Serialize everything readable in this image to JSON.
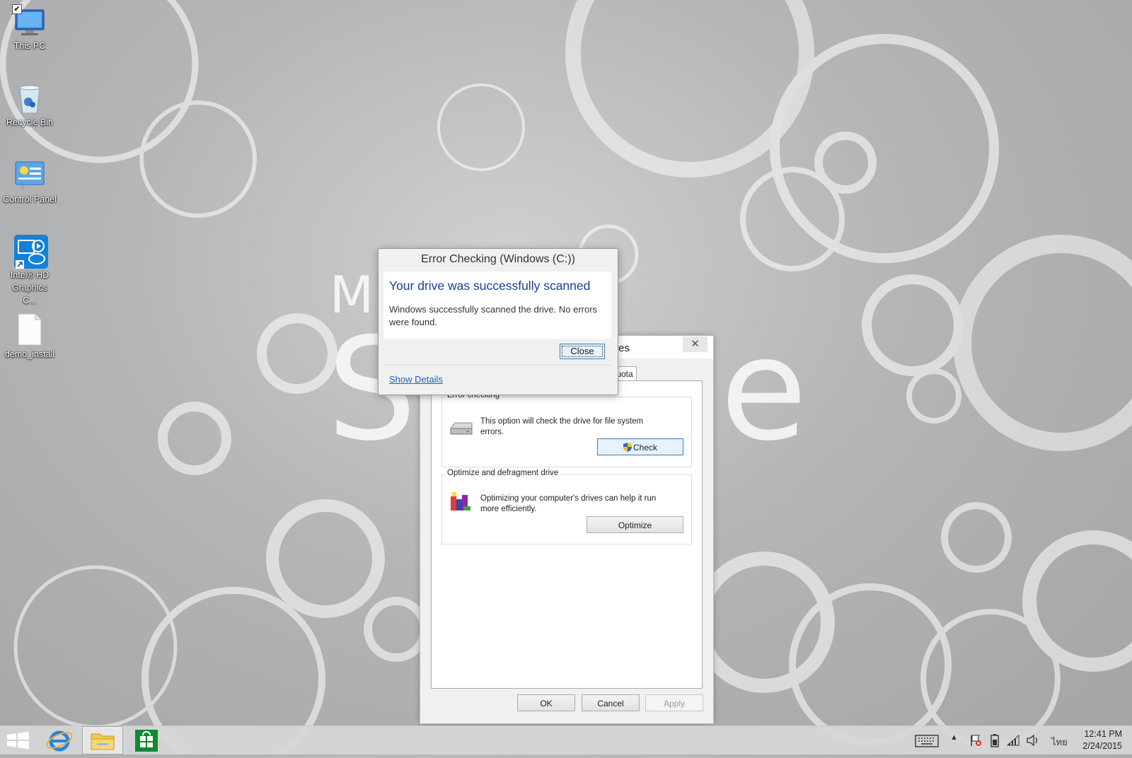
{
  "desktop": {
    "icons": [
      {
        "label": "This PC",
        "icon": "this-pc-icon",
        "checked": true
      },
      {
        "label": "Recycle Bin",
        "icon": "recycle-bin-icon"
      },
      {
        "label": "Control Panel",
        "icon": "control-panel-icon"
      },
      {
        "label": "Intel® HD Graphics C...",
        "icon": "intel-graphics-icon"
      },
      {
        "label": "demo_install",
        "icon": "document-icon"
      }
    ],
    "wallpaper_text_small": "Mi",
    "wallpaper_text_left": "Su",
    "wallpaper_text_right": "ce"
  },
  "properties_dialog": {
    "title_fragment": "es",
    "tab_fragment": "uota",
    "error_checking": {
      "group_title": "Error checking",
      "description": "This option will check the drive for file system errors.",
      "check_button": "Check"
    },
    "optimize": {
      "group_title": "Optimize and defragment drive",
      "description": "Optimizing your computer's drives can help it run more efficiently.",
      "optimize_button": "Optimize"
    },
    "buttons": {
      "ok": "OK",
      "cancel": "Cancel",
      "apply": "Apply"
    }
  },
  "error_dialog": {
    "title": "Error Checking (Windows (C:))",
    "heading": "Your drive was successfully scanned",
    "message": "Windows successfully scanned the drive. No errors were found.",
    "close_button": "Close",
    "show_details": "Show Details"
  },
  "taskbar": {
    "apps": [
      "start-button",
      "internet-explorer-icon",
      "file-explorer-icon",
      "store-icon"
    ],
    "language": "ไทย",
    "time": "12:41 PM",
    "date": "2/24/2015"
  },
  "colors": {
    "heading_blue": "#1a3d96",
    "link_blue": "#1f5fbf",
    "store_green": "#0f8a2f"
  }
}
